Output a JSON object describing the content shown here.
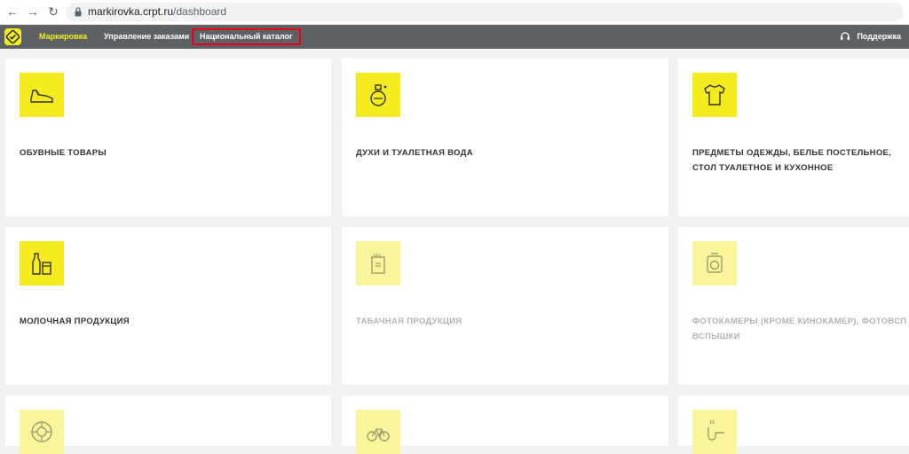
{
  "browser": {
    "url_host": "markirovka.crpt.ru",
    "url_path": "/dashboard",
    "back_icon": "arrow-left-icon",
    "forward_icon": "arrow-right-icon",
    "reload_icon": "reload-icon"
  },
  "nav": {
    "brand_color": "#f4ec1f",
    "items": [
      {
        "label": "Маркировка"
      },
      {
        "label": "Управление заказами"
      },
      {
        "label": "Национальный каталог"
      }
    ],
    "support_label": "Поддержка"
  },
  "categories": [
    {
      "title": "ОБУВНЫЕ ТОВАРЫ",
      "icon": "shoe-icon",
      "enabled": true
    },
    {
      "title": "ДУХИ И ТУАЛЕТНАЯ ВОДА",
      "icon": "perfume-icon",
      "enabled": true
    },
    {
      "title": "ПРЕДМЕТЫ ОДЕЖДЫ, БЕЛЬЕ ПОСТЕЛЬНОЕ, СТОЛ ТУАЛЕТНОЕ И КУХОННОЕ",
      "icon": "shirt-icon",
      "enabled": true
    },
    {
      "title": "МОЛОЧНАЯ ПРОДУКЦИЯ",
      "icon": "milk-icon",
      "enabled": true
    },
    {
      "title": "ТАБАЧНАЯ ПРОДУКЦИЯ",
      "icon": "cigarette-pack-icon",
      "enabled": false
    },
    {
      "title": "ФОТОКАМЕРЫ (КРОМЕ КИНОКАМЕР), ФОТОВСП ВСПЫШКИ",
      "icon": "camera-icon",
      "enabled": false
    },
    {
      "title": "",
      "icon": "tire-icon",
      "enabled": false
    },
    {
      "title": "",
      "icon": "bicycle-icon",
      "enabled": false
    },
    {
      "title": "",
      "icon": "pipe-icon",
      "enabled": false
    }
  ]
}
